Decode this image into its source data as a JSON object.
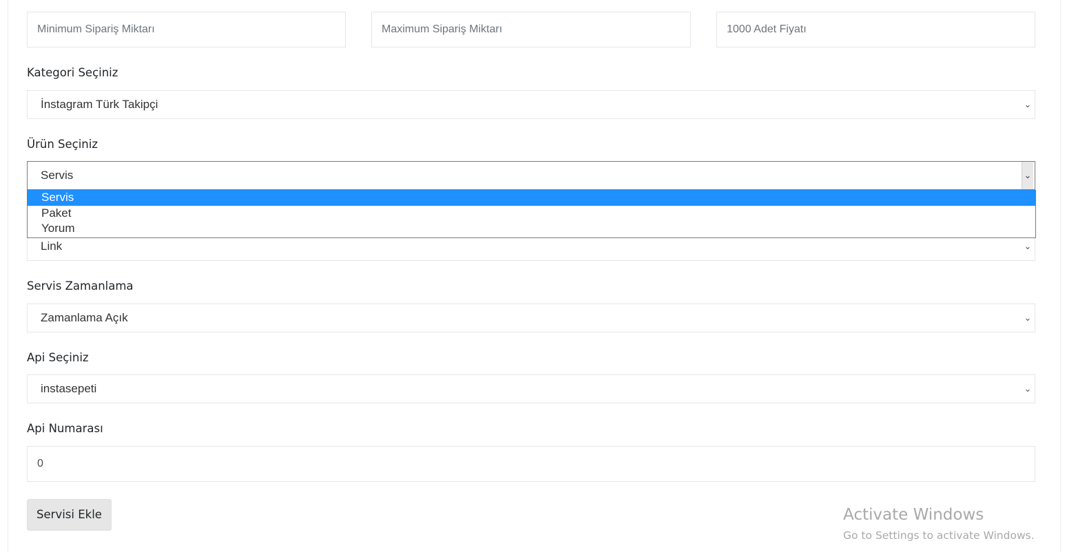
{
  "top_inputs": {
    "min_order": {
      "placeholder": "Minimum Sipariş Miktarı",
      "value": ""
    },
    "max_order": {
      "placeholder": "Maximum Sipariş Miktarı",
      "value": ""
    },
    "price_1000": {
      "placeholder": "1000 Adet Fiyatı",
      "value": ""
    }
  },
  "category": {
    "label": "Kategori Seçiniz",
    "selected": "İnstagram Türk Takipçi"
  },
  "product": {
    "label": "Ürün Seçiniz",
    "selected": "Servis",
    "options": [
      "Servis",
      "Paket",
      "Yorum"
    ]
  },
  "type_select": {
    "selected": "Link"
  },
  "scheduling": {
    "label": "Servis Zamanlama",
    "selected": "Zamanlama Açık"
  },
  "api": {
    "label": "Api Seçiniz",
    "selected": "instasepeti"
  },
  "api_number": {
    "label": "Api Numarası",
    "value": "0"
  },
  "submit": {
    "label": "Servisi Ekle"
  },
  "watermark": {
    "title": "Activate Windows",
    "subtitle": "Go to Settings to activate Windows."
  },
  "icons": {
    "chevron": "chevron-down-icon"
  }
}
